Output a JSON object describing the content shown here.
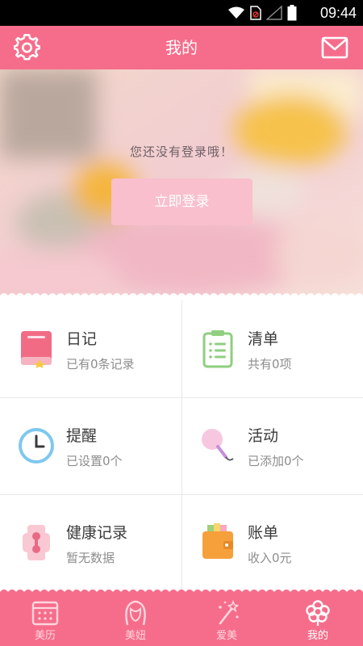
{
  "status_bar": {
    "time": "09:44"
  },
  "header": {
    "title": "我的",
    "icons": [
      "gear-icon",
      "mail-icon"
    ]
  },
  "hero": {
    "message": "您还没有登录哦！",
    "login_label": "立即登录"
  },
  "grid": {
    "items": [
      {
        "title": "日记",
        "subtitle": "已有0条记录",
        "icon": "diary-book-icon"
      },
      {
        "title": "清单",
        "subtitle": "共有0项",
        "icon": "clipboard-list-icon"
      },
      {
        "title": "提醒",
        "subtitle": "已设置0个",
        "icon": "clock-icon"
      },
      {
        "title": "活动",
        "subtitle": "已添加0个",
        "icon": "lollipop-icon"
      },
      {
        "title": "健康记录",
        "subtitle": "暂无数据",
        "icon": "health-icon"
      },
      {
        "title": "账单",
        "subtitle": "收入0元",
        "icon": "wallet-icon"
      }
    ]
  },
  "tabbar": {
    "tabs": [
      {
        "label": "美历",
        "icon": "calendar-icon"
      },
      {
        "label": "美妞",
        "icon": "girl-face-icon"
      },
      {
        "label": "爱美",
        "icon": "magic-wand-icon"
      },
      {
        "label": "我的",
        "icon": "flower-icon",
        "active": true
      }
    ]
  },
  "colors": {
    "brand_pink": "#f66d8b",
    "login_button": "#f9bfcc",
    "text_dark": "#3a3a3a",
    "text_gray": "#8d8d8d"
  }
}
